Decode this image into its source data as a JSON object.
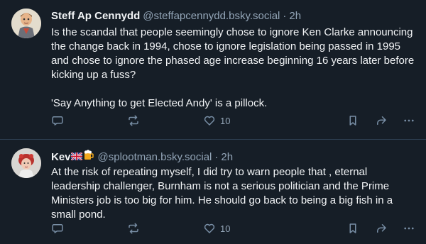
{
  "posts": [
    {
      "author": {
        "display_name": "Steff Ap Cennydd",
        "handle": "@steffapcennydd.bsky.social",
        "avatar_icon": "cartoon-figure-avatar"
      },
      "time": "2h",
      "separator": "·",
      "text": "Is the scandal that people seemingly chose to ignore Ken Clarke announcing the change back in 1994, chose to ignore legislation being passed in 1995 and chose to ignore the phased age increase beginning 16 years later before kicking up a fuss?\n\n'Say Anything to get Elected Andy' is a pillock.",
      "like_count": "10"
    },
    {
      "author": {
        "display_name": "Kev",
        "name_emoji": [
          "union-jack-flag",
          "beer-mug"
        ],
        "handle": "@splootman.bsky.social",
        "avatar_icon": "woman-portrait-avatar"
      },
      "time": "2h",
      "separator": "·",
      "text": "At the risk of repeating myself, I did try to warn people that , eternal leadership challenger, Burnham is not a serious politician and the Prime Ministers job is too big for him. He should go back to being a big fish in a small pond.",
      "like_count": "10"
    }
  ],
  "icons": {
    "reply": "speech-bubble-icon",
    "repost": "repost-arrows-icon",
    "like": "heart-icon",
    "bookmark": "bookmark-icon",
    "share": "share-arrow-icon",
    "more": "ellipsis-icon"
  },
  "colors": {
    "background": "#161e27",
    "text": "#f1f3f5",
    "muted": "#93a5b7",
    "icon": "#788ea5",
    "divider": "#2e4052"
  }
}
